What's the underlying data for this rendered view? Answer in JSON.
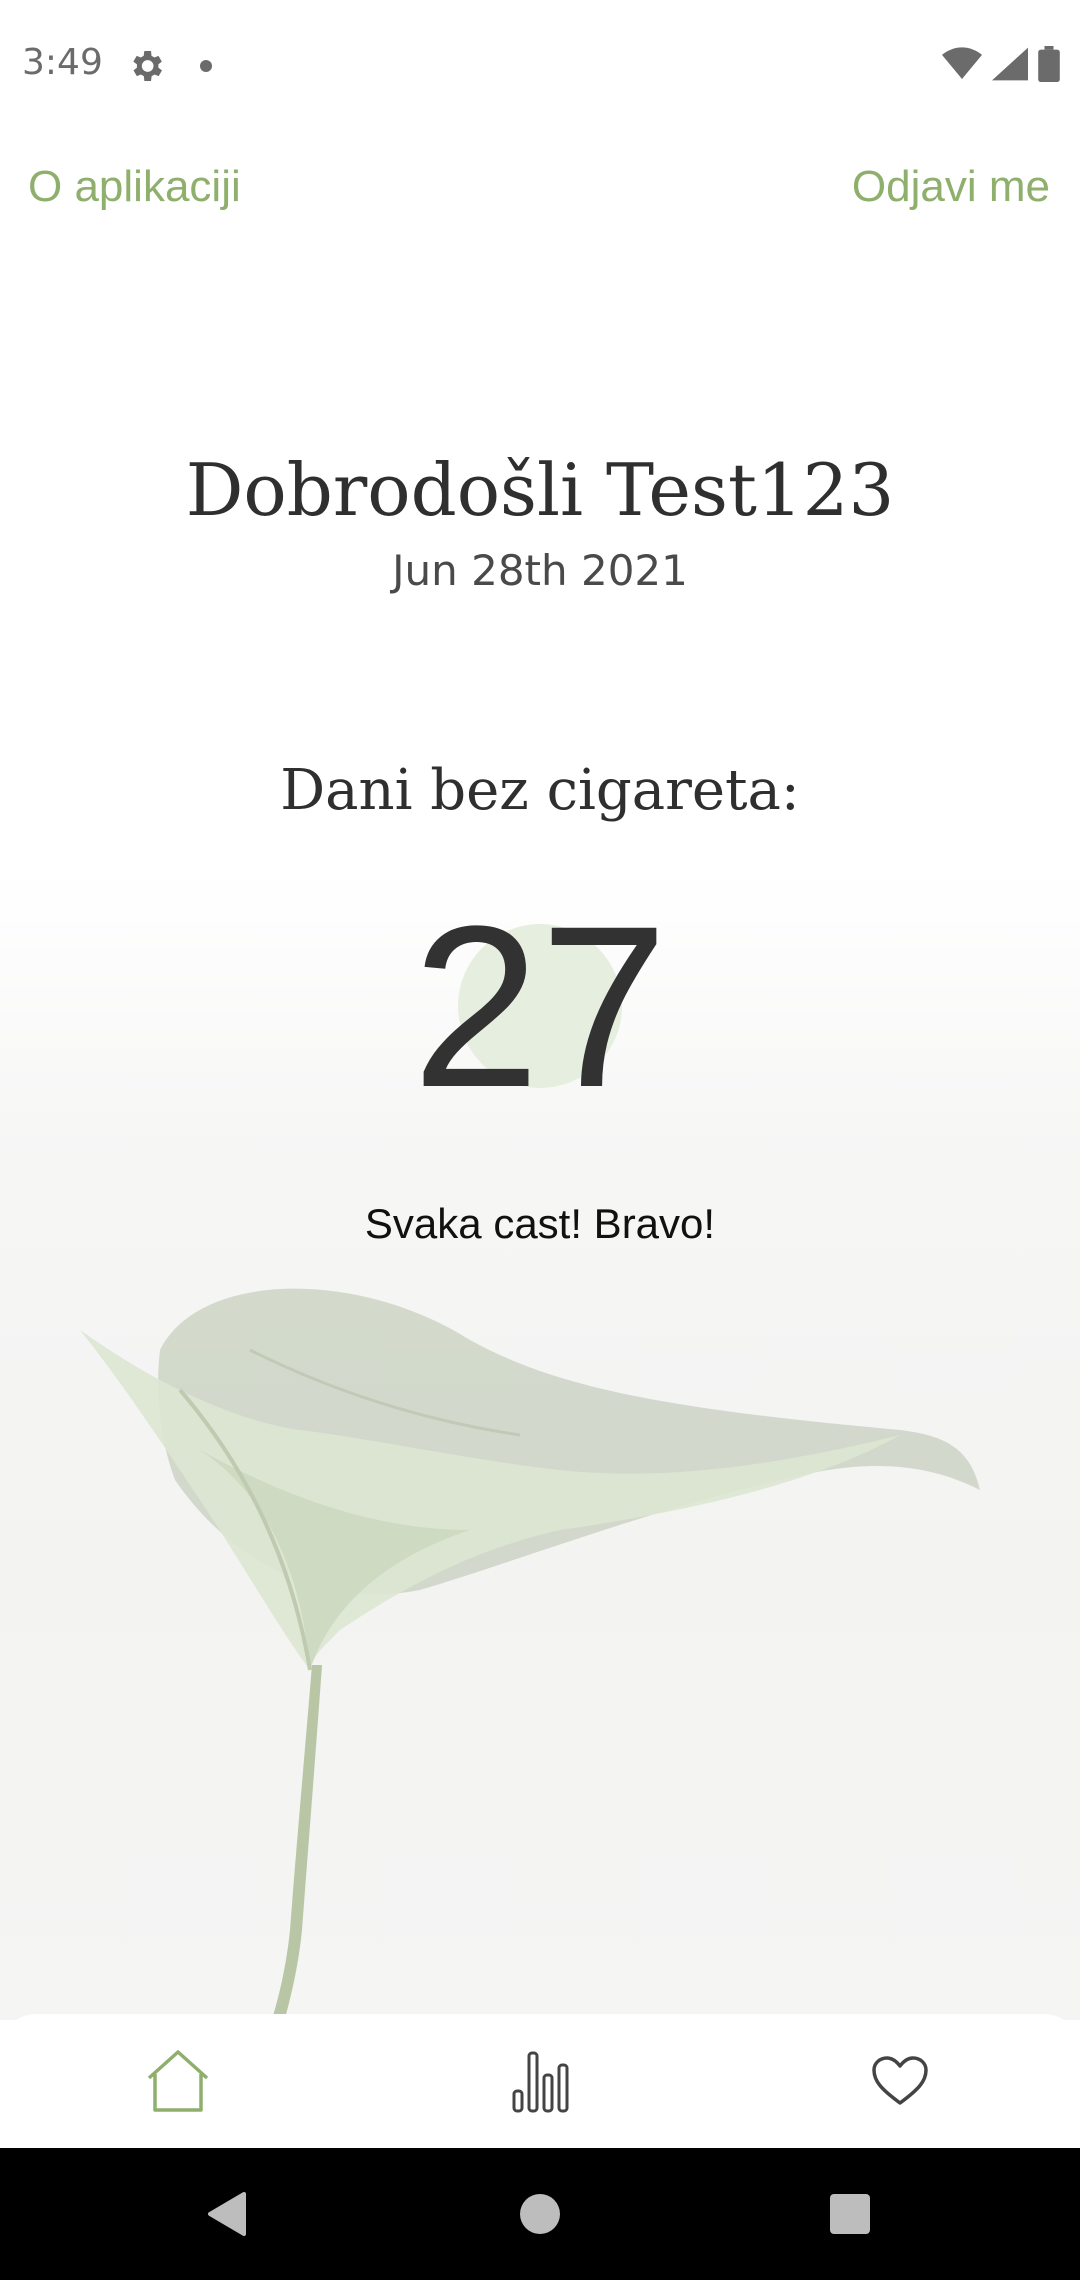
{
  "status_bar": {
    "time": "3:49",
    "icons": [
      "gear-icon",
      "notification-dot-icon",
      "wifi-icon",
      "signal-icon",
      "battery-icon"
    ]
  },
  "header": {
    "left_link": "O aplikaciji",
    "right_link": "Odjavi me"
  },
  "main": {
    "welcome": "Dobrodošli Test123",
    "date": "Jun 28th 2021",
    "days_label": "Dani bez cigareta:",
    "days_count": "27",
    "praise": "Svaka cast! Bravo!"
  },
  "bottom_nav": {
    "items": [
      {
        "icon": "home-icon",
        "active": true
      },
      {
        "icon": "bar-chart-icon",
        "active": false
      },
      {
        "icon": "heart-icon",
        "active": false
      }
    ]
  },
  "colors": {
    "accent": "#8faf6c",
    "text_dark": "#2f2f2f",
    "circle": "#e6eedf"
  }
}
